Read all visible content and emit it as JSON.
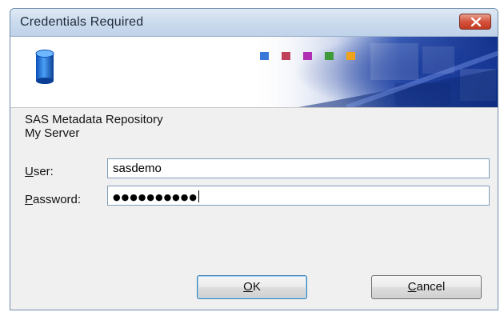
{
  "window": {
    "title": "Credentials Required"
  },
  "banner": {
    "icon": "database-icon",
    "squares": [
      "#3a78d8",
      "#c0415a",
      "#b12fb3",
      "#3f9a3a",
      "#f0a21a"
    ]
  },
  "info": {
    "line1": "SAS Metadata Repository",
    "line2": "My Server"
  },
  "form": {
    "user_label_mnemonic": "U",
    "user_label_rest": "ser:",
    "user_value": "sasdemo",
    "password_label_mnemonic": "P",
    "password_label_rest": "assword:",
    "password_value": "●●●●●●●●●●"
  },
  "buttons": {
    "ok_mnemonic": "O",
    "ok_rest": "K",
    "cancel_mnemonic": "C",
    "cancel_rest": "ancel"
  }
}
